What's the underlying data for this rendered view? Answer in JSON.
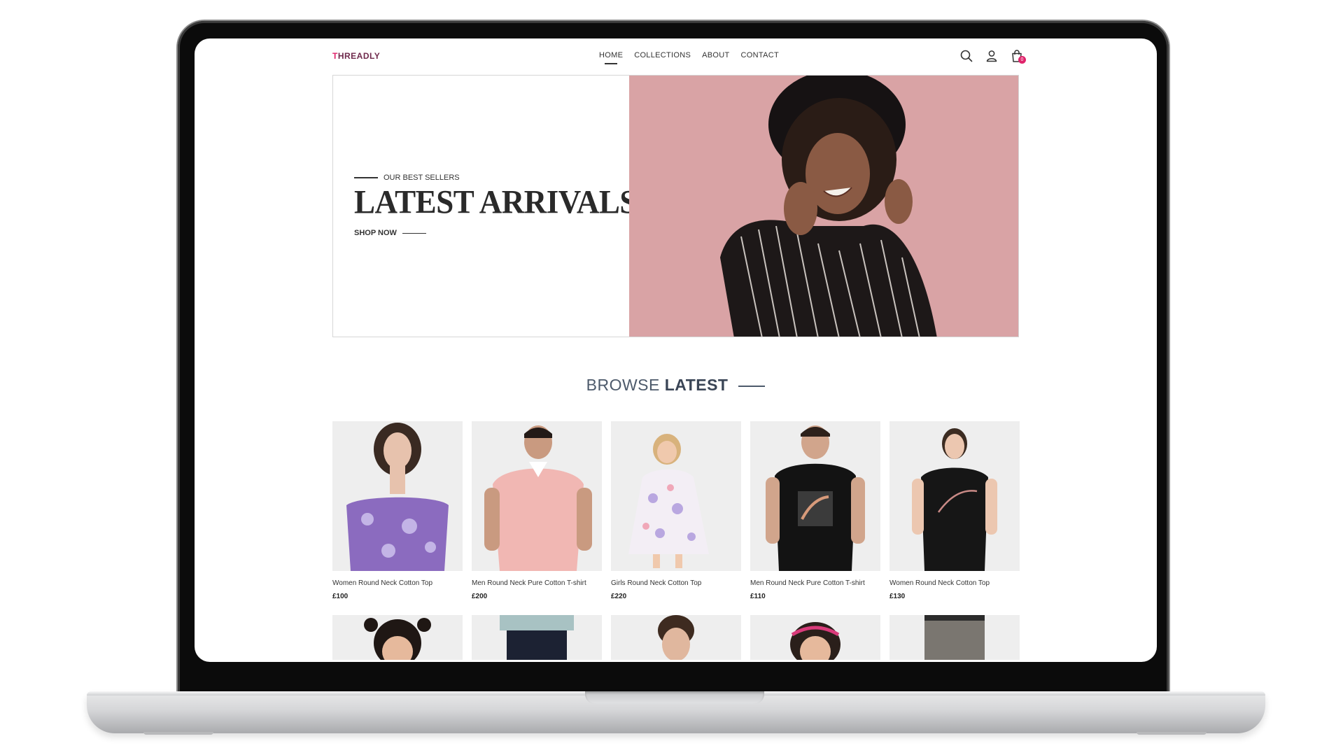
{
  "header": {
    "logo_first": "T",
    "logo_rest": "HREADLY",
    "nav": [
      {
        "label": "HOME",
        "active": true
      },
      {
        "label": "COLLECTIONS",
        "active": false
      },
      {
        "label": "ABOUT",
        "active": false
      },
      {
        "label": "CONTACT",
        "active": false
      }
    ],
    "icons": [
      "search-icon",
      "user-icon",
      "shopping-bag-icon"
    ],
    "cart_count": "0"
  },
  "hero": {
    "eyebrow": "OUR BEST SELLERS",
    "title": "LATEST ARRIVALS",
    "cta": "SHOP NOW",
    "image_background": "#d9a3a5"
  },
  "browse": {
    "title_light": "BROWSE",
    "title_bold": "LATEST"
  },
  "products": [
    {
      "name": "Women Round Neck Cotton Top",
      "price": "£100"
    },
    {
      "name": "Men Round Neck Pure Cotton T-shirt",
      "price": "£200"
    },
    {
      "name": "Girls Round Neck Cotton Top",
      "price": "£220"
    },
    {
      "name": "Men Round Neck Pure Cotton T-shirt",
      "price": "£110"
    },
    {
      "name": "Women Round Neck Cotton Top",
      "price": "£130"
    }
  ],
  "colors": {
    "accent": "#e0246b",
    "hero_pink": "#d9a3a5",
    "text_dark": "#2b2b2b",
    "browse_gray": "#4d5a6b"
  }
}
